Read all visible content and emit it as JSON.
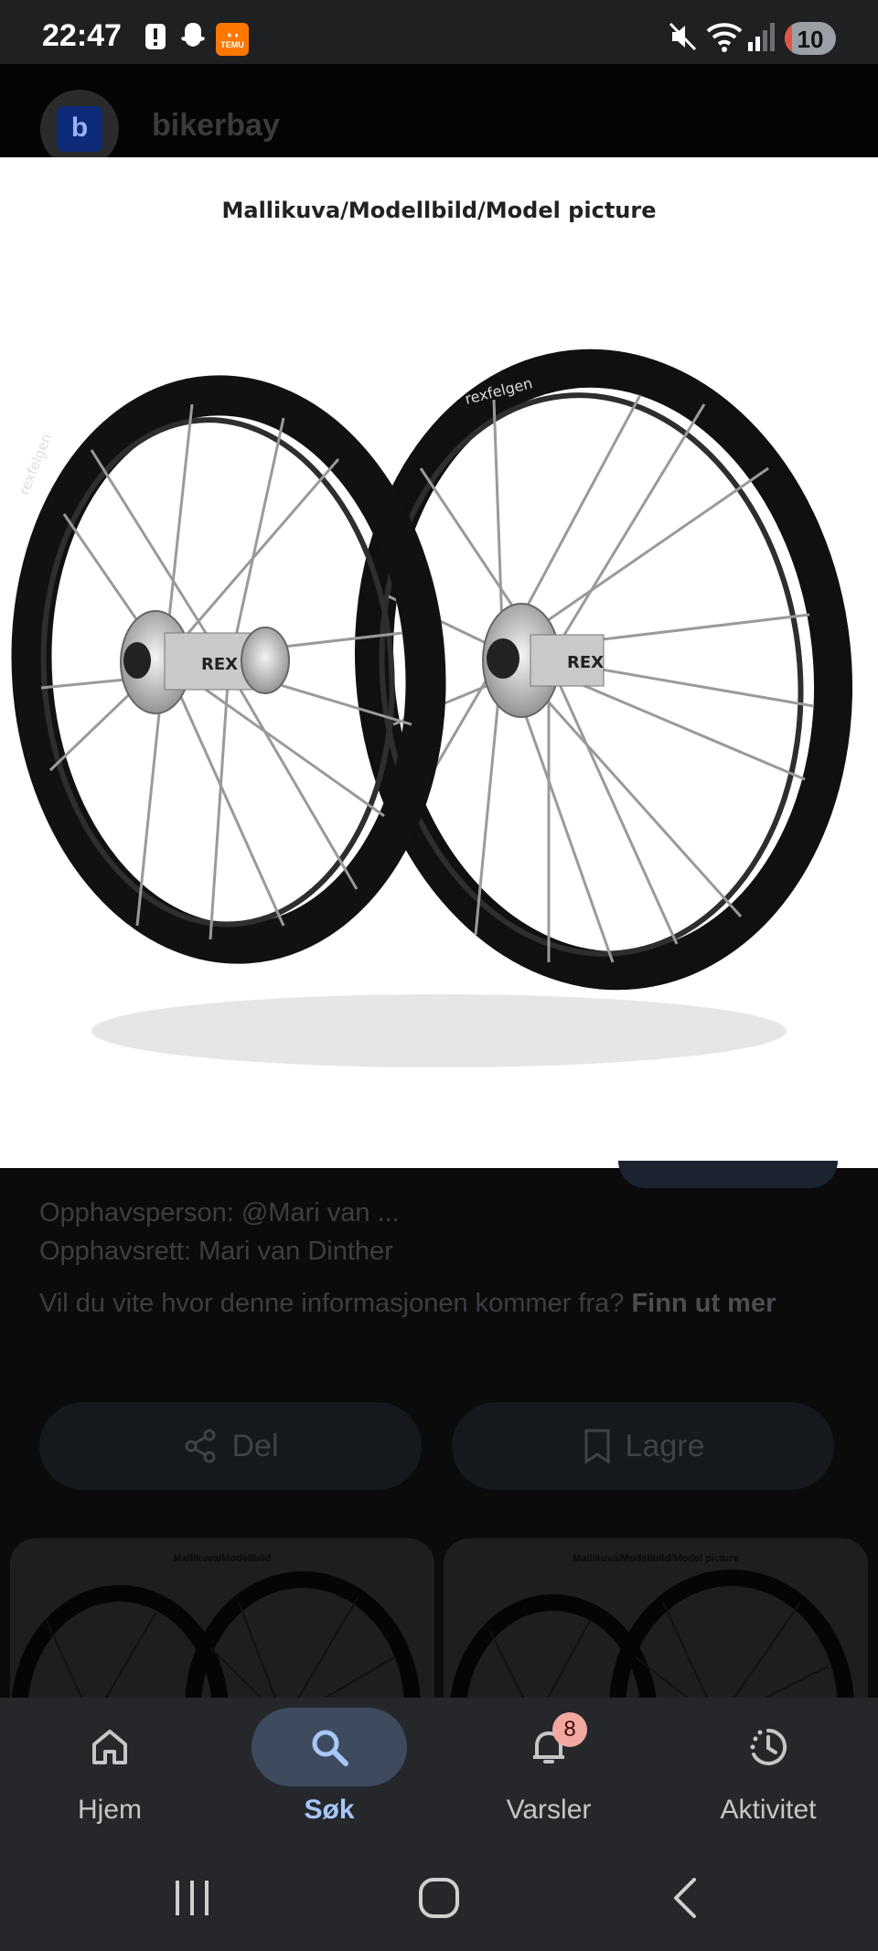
{
  "status_bar": {
    "time": "22:47",
    "temu_label": "TEMU",
    "battery_level": "10",
    "icons": [
      "alert-icon",
      "snapchat-icon",
      "temu-icon",
      "mute-icon",
      "wifi-icon",
      "signal-icon",
      "battery-icon"
    ]
  },
  "header": {
    "avatar_letter": "b",
    "site_name": "bikerbay"
  },
  "image": {
    "caption": "Mallikuva/Modellbild/Model picture",
    "brand_text": "rexfelgen",
    "hub_text": "REX"
  },
  "details": {
    "author": "Opphavsperson: @Mari van ...",
    "copyright": "Opphavsrett: Mari van Dinther",
    "info_question": "Vil du vite hvor denne informasjonen kommer fra?",
    "info_link": "Finn ut mer",
    "share_label": "Del",
    "save_label": "Lagre"
  },
  "related": [
    {
      "caption": "Mallikuva/Modellbild"
    },
    {
      "caption": "Mallikuva/Modellbild/Model picture"
    }
  ],
  "nav": {
    "items": [
      {
        "label": "Hjem",
        "icon": "home-icon",
        "active": false
      },
      {
        "label": "Søk",
        "icon": "search-icon",
        "active": true
      },
      {
        "label": "Varsler",
        "icon": "bell-icon",
        "active": false,
        "badge": "8"
      },
      {
        "label": "Aktivitet",
        "icon": "activity-icon",
        "active": false
      }
    ]
  },
  "system_nav": [
    "recents-button",
    "home-button",
    "back-button"
  ],
  "colors": {
    "accent": "#a8c7fa",
    "nav_bg": "#25272b",
    "active_pill": "#3e4a5e",
    "badge": "#f2a7a0"
  }
}
